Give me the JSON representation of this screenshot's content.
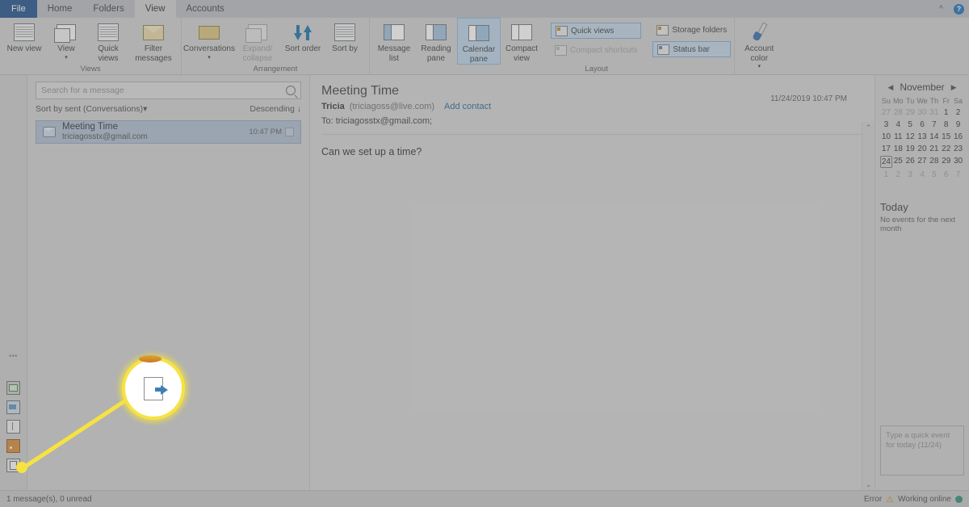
{
  "window": {
    "tabs": [
      {
        "label": "File",
        "state": "file"
      },
      {
        "label": "Home",
        "state": "normal"
      },
      {
        "label": "Folders",
        "state": "normal"
      },
      {
        "label": "View",
        "state": "active"
      },
      {
        "label": "Accounts",
        "state": "normal"
      }
    ],
    "collapse_ribbon_icon": "chevron-up-icon",
    "help_icon": "help-icon",
    "help_glyph": "?"
  },
  "ribbon": {
    "groups": [
      {
        "name": "Views",
        "label": "Views",
        "buttons": [
          {
            "label": "New view",
            "icon": "grid-view-icon",
            "has_caret": false,
            "disabled": false,
            "selected": false
          },
          {
            "label": "View",
            "icon": "stacked-views-icon",
            "has_caret": true,
            "disabled": false,
            "selected": false
          },
          {
            "label": "Quick views",
            "icon": "quick-views-icon",
            "has_caret": false,
            "disabled": false,
            "selected": false
          },
          {
            "label": "Filter messages",
            "icon": "filter-messages-icon",
            "has_caret": true,
            "disabled": false,
            "selected": false
          }
        ]
      },
      {
        "name": "Arrangement",
        "label": "Arrangement",
        "buttons": [
          {
            "label": "Conversations",
            "icon": "conversations-icon",
            "has_caret": true,
            "disabled": false,
            "selected": false
          },
          {
            "label": "Expand/ collapse",
            "icon": "expand-collapse-icon",
            "has_caret": true,
            "disabled": true,
            "selected": false
          },
          {
            "label": "Sort order",
            "icon": "sort-order-icon",
            "has_caret": true,
            "disabled": false,
            "selected": false
          },
          {
            "label": "Sort by",
            "icon": "sort-by-icon",
            "has_caret": true,
            "disabled": false,
            "selected": false
          }
        ]
      },
      {
        "name": "Layout",
        "label": "Layout",
        "buttons": [
          {
            "label": "Message list",
            "icon": "message-list-icon",
            "has_caret": true,
            "disabled": false,
            "selected": false
          },
          {
            "label": "Reading pane",
            "icon": "reading-pane-icon",
            "has_caret": true,
            "disabled": false,
            "selected": false
          },
          {
            "label": "Calendar pane",
            "icon": "calendar-pane-icon",
            "has_caret": false,
            "disabled": false,
            "selected": true
          },
          {
            "label": "Compact view",
            "icon": "compact-view-icon",
            "has_caret": false,
            "disabled": false,
            "selected": false
          }
        ],
        "toggles": [
          {
            "label": "Quick views",
            "icon": "quick-views-toggle-icon",
            "state": "on",
            "color": "orange"
          },
          {
            "label": "Compact shortcuts",
            "icon": "compact-shortcuts-toggle-icon",
            "state": "off",
            "color": "grey"
          },
          {
            "label": "Storage folders",
            "icon": "storage-folders-toggle-icon",
            "state": "plain",
            "color": "orange"
          },
          {
            "label": "Status bar",
            "icon": "status-bar-toggle-icon",
            "state": "on",
            "color": "blue"
          }
        ]
      },
      {
        "name": "AccountColor",
        "label": "",
        "buttons": [
          {
            "label": "Account color",
            "icon": "paintbrush-icon",
            "has_caret": true,
            "disabled": false,
            "selected": false
          }
        ]
      }
    ]
  },
  "left_rail": {
    "items": [
      {
        "name": "mail-icon",
        "label": "Mail"
      },
      {
        "name": "calendar-icon",
        "label": "Calendar"
      },
      {
        "name": "contacts-icon",
        "label": "Contacts"
      },
      {
        "name": "feeds-icon",
        "label": "Feeds"
      },
      {
        "name": "files-icon",
        "label": "Files"
      }
    ],
    "overflow_glyph": "•••"
  },
  "message_list": {
    "search": {
      "placeholder": "Search for a message",
      "value": "",
      "icon": "search-icon"
    },
    "sort_label": "Sort by sent (Conversations)",
    "sort_caret": "▾",
    "direction_label": "Descending",
    "direction_arrow": "↓",
    "messages": [
      {
        "subject": "Meeting Time",
        "from": "triciagosstx@gmail.com",
        "time": "10:47 PM",
        "envelope_icon": "envelope-icon",
        "flag_icon": "flag-icon",
        "selected": true
      }
    ]
  },
  "reading_pane": {
    "subject": "Meeting Time",
    "sender_name": "Tricia",
    "sender_email": "(triciagoss@live.com)",
    "add_contact_label": "Add contact",
    "to_label": "To:",
    "to_value": "triciagosstx@gmail.com;",
    "date": "11/24/2019 10:47 PM",
    "body": "Can we set up a time?",
    "scroll_up_glyph": "⌃",
    "scroll_down_glyph": "⌄"
  },
  "calendar_pane": {
    "prev_glyph": "◀",
    "next_glyph": "▶",
    "month": "November",
    "weekdays": [
      "Su",
      "Mo",
      "Tu",
      "We",
      "Th",
      "Fr",
      "Sa"
    ],
    "weeks": [
      [
        {
          "n": "27",
          "dim": true,
          "today": false
        },
        {
          "n": "28",
          "dim": true,
          "today": false
        },
        {
          "n": "29",
          "dim": true,
          "today": false
        },
        {
          "n": "30",
          "dim": true,
          "today": false
        },
        {
          "n": "31",
          "dim": true,
          "today": false
        },
        {
          "n": "1",
          "dim": false,
          "today": false
        },
        {
          "n": "2",
          "dim": false,
          "today": false
        }
      ],
      [
        {
          "n": "3",
          "dim": false,
          "today": false
        },
        {
          "n": "4",
          "dim": false,
          "today": false
        },
        {
          "n": "5",
          "dim": false,
          "today": false
        },
        {
          "n": "6",
          "dim": false,
          "today": false
        },
        {
          "n": "7",
          "dim": false,
          "today": false
        },
        {
          "n": "8",
          "dim": false,
          "today": false
        },
        {
          "n": "9",
          "dim": false,
          "today": false
        }
      ],
      [
        {
          "n": "10",
          "dim": false,
          "today": false
        },
        {
          "n": "11",
          "dim": false,
          "today": false
        },
        {
          "n": "12",
          "dim": false,
          "today": false
        },
        {
          "n": "13",
          "dim": false,
          "today": false
        },
        {
          "n": "14",
          "dim": false,
          "today": false
        },
        {
          "n": "15",
          "dim": false,
          "today": false
        },
        {
          "n": "16",
          "dim": false,
          "today": false
        }
      ],
      [
        {
          "n": "17",
          "dim": false,
          "today": false
        },
        {
          "n": "18",
          "dim": false,
          "today": false
        },
        {
          "n": "19",
          "dim": false,
          "today": false
        },
        {
          "n": "20",
          "dim": false,
          "today": false
        },
        {
          "n": "21",
          "dim": false,
          "today": false
        },
        {
          "n": "22",
          "dim": false,
          "today": false
        },
        {
          "n": "23",
          "dim": false,
          "today": false
        }
      ],
      [
        {
          "n": "24",
          "dim": false,
          "today": true
        },
        {
          "n": "25",
          "dim": false,
          "today": false
        },
        {
          "n": "26",
          "dim": false,
          "today": false
        },
        {
          "n": "27",
          "dim": false,
          "today": false
        },
        {
          "n": "28",
          "dim": false,
          "today": false
        },
        {
          "n": "29",
          "dim": false,
          "today": false
        },
        {
          "n": "30",
          "dim": false,
          "today": false
        }
      ],
      [
        {
          "n": "1",
          "dim": true,
          "today": false
        },
        {
          "n": "2",
          "dim": true,
          "today": false
        },
        {
          "n": "3",
          "dim": true,
          "today": false
        },
        {
          "n": "4",
          "dim": true,
          "today": false
        },
        {
          "n": "5",
          "dim": true,
          "today": false
        },
        {
          "n": "6",
          "dim": true,
          "today": false
        },
        {
          "n": "7",
          "dim": true,
          "today": false
        }
      ]
    ],
    "today_title": "Today",
    "today_text": "No events for the next month",
    "quick_event_placeholder": "Type a quick event for today (11/24)",
    "quick_event_value": ""
  },
  "status_bar": {
    "left_text": "1 message(s), 0 unread",
    "error_label": "Error",
    "warning_icon": "warning-icon",
    "warning_glyph": "⚠",
    "connection_label": "Working online",
    "connection_icon": "online-status-icon"
  },
  "callout": {
    "magnified_icon": "files-icon",
    "highlight_color": "#f6e242"
  }
}
